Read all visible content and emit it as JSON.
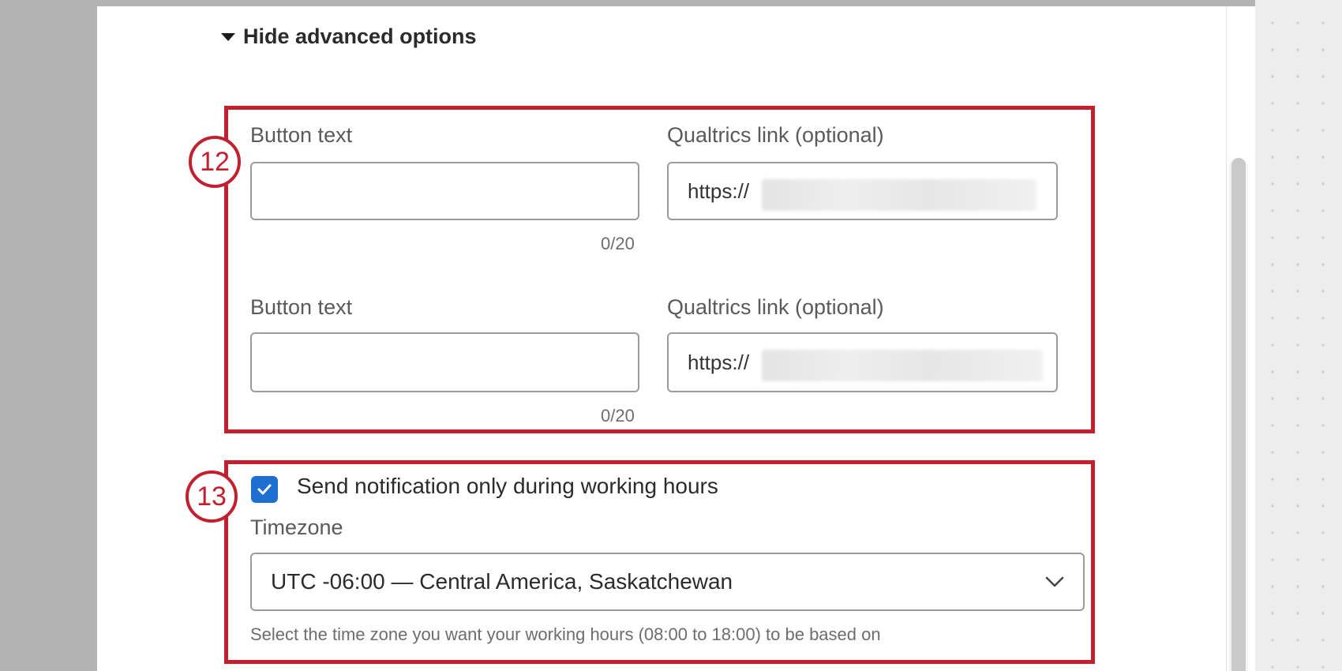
{
  "advanced": {
    "toggle_label": "Hide advanced options"
  },
  "callouts": {
    "step_a": "12",
    "step_b": "13"
  },
  "buttons": [
    {
      "button_text_label": "Button text",
      "button_text_value": "",
      "counter": "0/20",
      "link_label": "Qualtrics link (optional)",
      "link_value": "https://"
    },
    {
      "button_text_label": "Button text",
      "button_text_value": "",
      "counter": "0/20",
      "link_label": "Qualtrics link (optional)",
      "link_value": "https://"
    }
  ],
  "working_hours": {
    "checkbox_checked": true,
    "checkbox_label": "Send notification only during working hours",
    "timezone_label": "Timezone",
    "timezone_value": "UTC -06:00 — Central America, Saskatchewan",
    "helper_text": "Select the time zone you want your working hours (08:00 to 18:00) to be based on"
  },
  "colors": {
    "callout_red": "#c21f2f",
    "checkbox_blue": "#1f6fd1"
  },
  "icons": {
    "toggle": "caret-down-icon",
    "checkbox": "checkmark-icon",
    "select": "chevron-down-icon"
  }
}
